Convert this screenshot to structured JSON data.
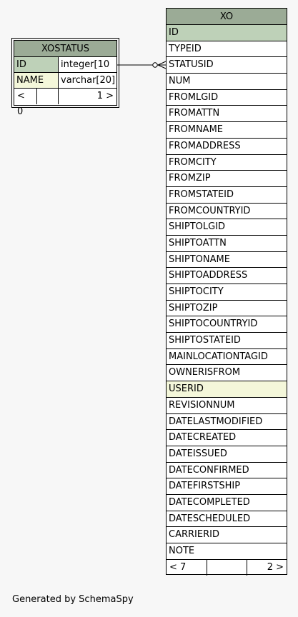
{
  "xostatus": {
    "title": "XOSTATUS",
    "rows": [
      {
        "name": "ID",
        "type": "integer[10",
        "kind": "pk"
      },
      {
        "name": "NAME",
        "type": "varchar[20]",
        "kind": "fk"
      }
    ],
    "footer": {
      "left": "< 0",
      "middle": "",
      "right": "1 >"
    }
  },
  "xo": {
    "title": "XO",
    "columns": [
      {
        "name": "ID",
        "kind": "pk"
      },
      {
        "name": "TYPEID",
        "kind": "normal"
      },
      {
        "name": "STATUSID",
        "kind": "normal"
      },
      {
        "name": "NUM",
        "kind": "normal"
      },
      {
        "name": "FROMLGID",
        "kind": "normal"
      },
      {
        "name": "FROMATTN",
        "kind": "normal"
      },
      {
        "name": "FROMNAME",
        "kind": "normal"
      },
      {
        "name": "FROMADDRESS",
        "kind": "normal"
      },
      {
        "name": "FROMCITY",
        "kind": "normal"
      },
      {
        "name": "FROMZIP",
        "kind": "normal"
      },
      {
        "name": "FROMSTATEID",
        "kind": "normal"
      },
      {
        "name": "FROMCOUNTRYID",
        "kind": "normal"
      },
      {
        "name": "SHIPTOLGID",
        "kind": "normal"
      },
      {
        "name": "SHIPTOATTN",
        "kind": "normal"
      },
      {
        "name": "SHIPTONAME",
        "kind": "normal"
      },
      {
        "name": "SHIPTOADDRESS",
        "kind": "normal"
      },
      {
        "name": "SHIPTOCITY",
        "kind": "normal"
      },
      {
        "name": "SHIPTOZIP",
        "kind": "normal"
      },
      {
        "name": "SHIPTOCOUNTRYID",
        "kind": "normal"
      },
      {
        "name": "SHIPTOSTATEID",
        "kind": "normal"
      },
      {
        "name": "MAINLOCATIONTAGID",
        "kind": "normal"
      },
      {
        "name": "OWNERISFROM",
        "kind": "normal"
      },
      {
        "name": "USERID",
        "kind": "fk"
      },
      {
        "name": "REVISIONNUM",
        "kind": "normal"
      },
      {
        "name": "DATELASTMODIFIED",
        "kind": "normal"
      },
      {
        "name": "DATECREATED",
        "kind": "normal"
      },
      {
        "name": "DATEISSUED",
        "kind": "normal"
      },
      {
        "name": "DATECONFIRMED",
        "kind": "normal"
      },
      {
        "name": "DATEFIRSTSHIP",
        "kind": "normal"
      },
      {
        "name": "DATECOMPLETED",
        "kind": "normal"
      },
      {
        "name": "DATESCHEDULED",
        "kind": "normal"
      },
      {
        "name": "CARRIERID",
        "kind": "normal"
      },
      {
        "name": "NOTE",
        "kind": "normal"
      }
    ],
    "footer": {
      "left": "< 7",
      "middle": "",
      "right": "2 >"
    }
  },
  "footer_text": "Generated by SchemaSpy",
  "colors": {
    "title_bg": "#9bab96",
    "pk_bg": "#bed1b8",
    "fk_bg": "#f4f7da",
    "background": "#f7f7f7"
  }
}
